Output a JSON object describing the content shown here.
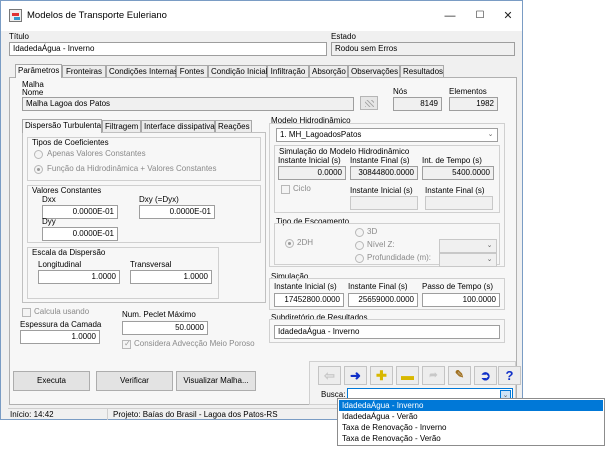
{
  "window": {
    "title": "Modelos de Transporte Euleriano",
    "min": "—",
    "max": "☐",
    "close": "✕"
  },
  "header": {
    "titulo_label": "Título",
    "titulo_value": "IdadedaÁgua - Inverno",
    "estado_label": "Estado",
    "estado_value": "Rodou sem Erros"
  },
  "tabs": [
    "Parâmetros",
    "Fronteiras",
    "Condições Internas",
    "Fontes",
    "Condição Inicial",
    "Infiltração",
    "Absorção",
    "Observações",
    "Resultados"
  ],
  "malha": {
    "label": "Malha",
    "nome_label": "Nome",
    "nome_value": "Malha Lagoa dos Patos",
    "nos_label": "Nós",
    "nos_value": "8149",
    "elementos_label": "Elementos",
    "elementos_value": "1982"
  },
  "subtabs": [
    "Dispersão Turbulenta",
    "Filtragem",
    "Interface dissipativa",
    "Reações"
  ],
  "dispersao": {
    "tipos_label": "Tipos de Coeficientes",
    "radio1": "Apenas Valores Constantes",
    "radio2": "Função da Hidrodinâmica + Valores Constantes",
    "valores_label": "Valores Constantes",
    "dxx_label": "Dxx",
    "dxx_value": "0.0000E-01",
    "dxy_label": "Dxy (=Dyx)",
    "dxy_value": "0.0000E-01",
    "dyy_label": "Dyy",
    "dyy_value": "0.0000E-01",
    "escala_label": "Escala da Dispersão",
    "longitudinal_label": "Longitudinal",
    "longitudinal_value": "1.0000",
    "transversal_label": "Transversal",
    "transversal_value": "1.0000"
  },
  "camada": {
    "calcula_label": "Calcula usando",
    "espessura_label": "Espessura da Camada",
    "espessura_value": "1.0000",
    "peclet_label": "Num. Peclet Máximo",
    "peclet_value": "50.0000",
    "adveccao_label": "Considera Advecção Meio Poroso"
  },
  "hidro": {
    "label": "Modelo Hidrodinâmico",
    "selected": "1. MH_LagoadosPatos",
    "sim_label": "Simulação do Modelo Hidrodinâmico",
    "inst_ini_label": "Instante Inicial (s)",
    "inst_ini_value": "0.0000",
    "inst_fin_label": "Instante Final (s)",
    "inst_fin_value": "30844800.0000",
    "int_tempo_label": "Int. de Tempo (s)",
    "int_tempo_value": "5400.0000",
    "ciclo_label": "Ciclo",
    "ciclo_ini_label": "Instante Inicial (s)",
    "ciclo_fin_label": "Instante Final (s)",
    "escoamento_label": "Tipo de Escoamento",
    "r2dh": "2DH",
    "r3d": "3D",
    "nivel_label": "Nível Z:",
    "prof_label": "Profundidade (m):"
  },
  "simulacao": {
    "label": "Simulação",
    "ini_label": "Instante Inicial (s)",
    "ini_value": "17452800.0000",
    "fin_label": "Instante Final (s)",
    "fin_value": "25659000.0000",
    "passo_label": "Passo de Tempo (s)",
    "passo_value": "100.0000"
  },
  "subdir": {
    "label": "Subdiretório de Resultados",
    "value": "IdadedaÁgua - Inverno"
  },
  "buttons": {
    "executa": "Executa",
    "verificar": "Verificar",
    "visualizar": "Visualizar Malha..."
  },
  "busca": {
    "label": "Busca:",
    "value": ""
  },
  "dropdown": [
    "IdadedaÁgua - Inverno",
    "IdadedaÁgua - Verão",
    "Taxa de Renovação - Inverno",
    "Taxa de Renovação - Verão"
  ],
  "status": {
    "inicio": "Início: 14:42",
    "projeto": "Projeto: Baías do Brasil - Lagoa dos Patos-RS"
  },
  "colors": {
    "arrow_blue": "#1030c8",
    "add_yellow": "#e8c800",
    "highlight": "#0078d7"
  }
}
